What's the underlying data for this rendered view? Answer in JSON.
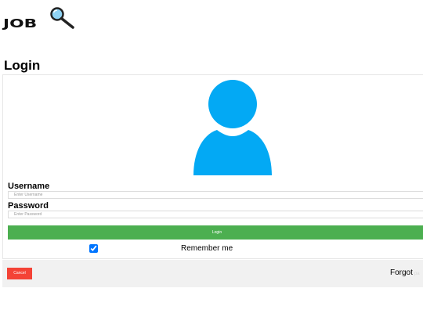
{
  "logo": {
    "text": "JOB"
  },
  "page": {
    "title": "Login"
  },
  "form": {
    "username_label": "Username",
    "username_placeholder": "Enter Username",
    "password_label": "Password",
    "password_placeholder": "Enter Password",
    "login_label": "Login",
    "remember_label": "Remember me",
    "remember_checked": true
  },
  "footer": {
    "cancel_label": "Cancel",
    "forgot_text": "Forgot",
    "forgot_link": "pa"
  },
  "colors": {
    "avatar": "#03a9f4",
    "login_button": "#4caf50",
    "cancel_button": "#f44336",
    "footer_bg": "#f1f1f1"
  }
}
